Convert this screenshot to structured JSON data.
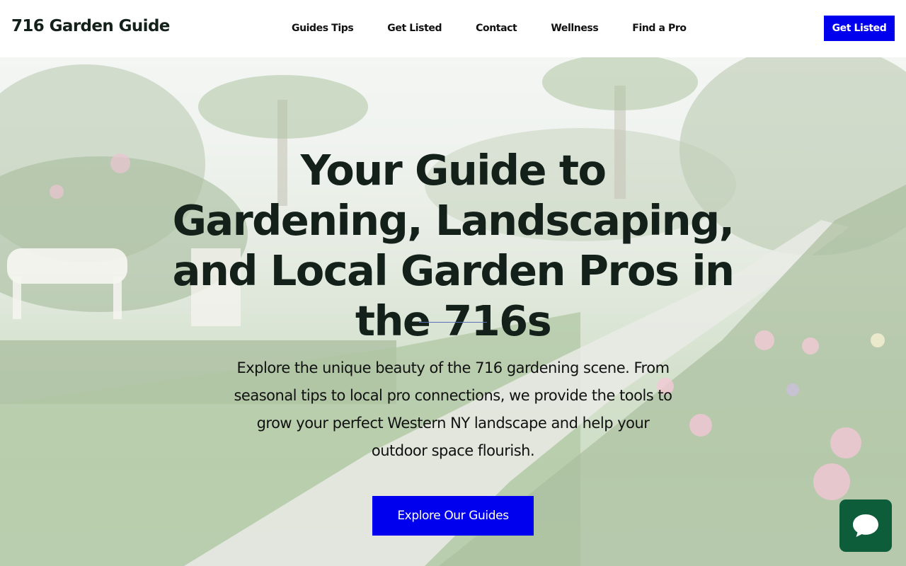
{
  "header": {
    "brand": "716 Garden Guide",
    "nav": [
      {
        "label": "Guides Tips"
      },
      {
        "label": "Get Listed"
      },
      {
        "label": "Contact"
      },
      {
        "label": "Wellness"
      },
      {
        "label": "Find a Pro"
      }
    ],
    "cta_label": "Get Listed"
  },
  "hero": {
    "title": "Your Guide to Gardening, Landscaping, and Local Garden Pros in the 716s",
    "body": "Explore the unique beauty of the 716 gardening scene. From seasonal tips to local pro connections, we provide the tools to grow your perfect Western NY landscape and help your outdoor space flourish.",
    "cta_label": "Explore Our Guides",
    "background_icon": "garden-path-photo"
  },
  "chat": {
    "icon": "chat-bubble-icon"
  },
  "colors": {
    "accent": "#0000ee",
    "chat": "#0d5c3a",
    "heading": "#14201a"
  }
}
